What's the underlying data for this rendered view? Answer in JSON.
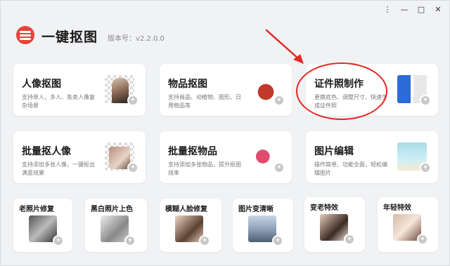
{
  "app": {
    "title": "一键抠图",
    "version": "版本号：v2.2.0.0"
  },
  "window_controls": {
    "menu": "⋮",
    "minimize": "—",
    "maximize": "□",
    "close": "✕"
  },
  "big_cards": [
    {
      "title": "人像抠图",
      "desc": "支持单人、多人、各类人像复杂场景"
    },
    {
      "title": "物品抠图",
      "desc": "支持商品、动植物、图形、日用物品等"
    },
    {
      "title": "证件照制作",
      "desc": "更换底色、调整尺寸、快速生成证件照"
    },
    {
      "title": "批量抠人像",
      "desc": "支持添加多张人像，一键抠出满意效果"
    },
    {
      "title": "批量抠物品",
      "desc": "支持添加多张物品，提升抠图效率"
    },
    {
      "title": "图片编辑",
      "desc": "操作简单、功能全面，轻松编辑图片"
    }
  ],
  "small_cards": [
    {
      "title": "老照片修复"
    },
    {
      "title": "黑白照片上色"
    },
    {
      "title": "模糊人脸修复"
    },
    {
      "title": "图片变清晰"
    },
    {
      "title": "变老特效"
    },
    {
      "title": "年轻特效"
    }
  ],
  "badge_icon": "wand-icon",
  "colors": {
    "accent_red": "#e8433a",
    "annotation_red": "#e02b25"
  }
}
